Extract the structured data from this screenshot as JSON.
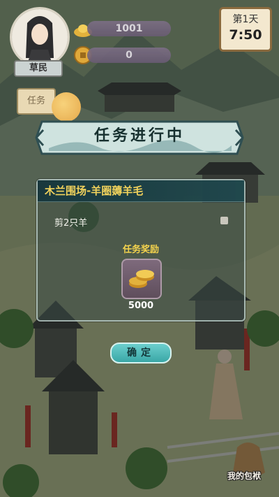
{
  "hud": {
    "rank_label": "草民",
    "coins": "1001",
    "tokens": "0",
    "day_label": "第1天",
    "time_label": "7:50",
    "task_flag_label": "任务"
  },
  "dialog": {
    "banner_title": "任务进行中",
    "task_title": "木兰围场-羊圈薅羊毛",
    "objective": "剪2只羊",
    "reward_title": "任务奖励",
    "reward_amount": "5000",
    "confirm_label": "确定"
  },
  "footer": {
    "bag_label": "我的包袱"
  },
  "colors": {
    "banner_bg": "#cfe3df",
    "task_title": "#f1d25c",
    "reward_title": "#f3d24d",
    "confirm_button": "#4bb9b8"
  },
  "icons": [
    "avatar-portrait",
    "gold-ingot-icon",
    "coin-icon",
    "coin-stack-icon",
    "bag-icon"
  ]
}
